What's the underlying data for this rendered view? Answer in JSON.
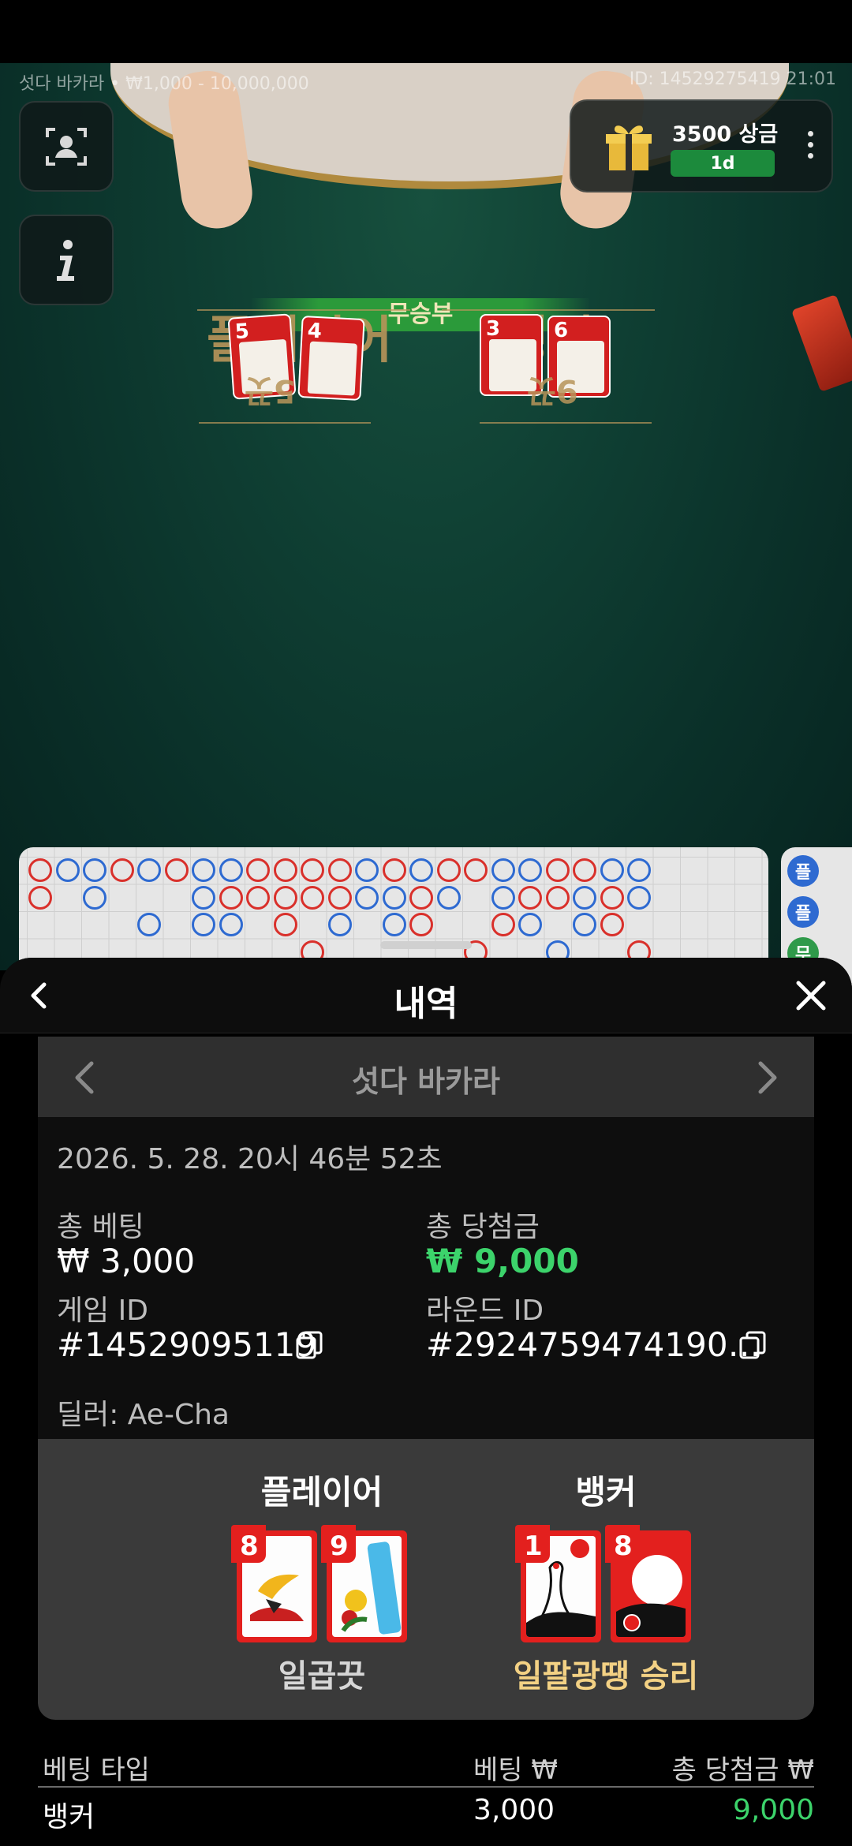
{
  "game": {
    "table_info": "섯다 바카라 • ₩1,000 - 10,000,000",
    "round_info": "ID: 14529275419 21:01",
    "prize": {
      "title": "3500 상금",
      "badge": "1d"
    },
    "tie_label": "무승부",
    "player_label": "플레이어",
    "banker_label": "뱅커",
    "player_cards": [
      "5",
      "4"
    ],
    "banker_cards": [
      "3",
      "6"
    ],
    "player_score": "5끗",
    "banker_score": "9끗",
    "roadmap_side": [
      "플",
      "플",
      "무"
    ]
  },
  "history": {
    "title": "내역",
    "game_name": "섯다 바카라",
    "datetime": "2026. 5. 28. 20시 46분 52초",
    "total_bet_label": "총 베팅",
    "total_bet": "₩ 3,000",
    "total_win_label": "총 당첨금",
    "total_win": "₩ 9,000",
    "game_id_label": "게임 ID",
    "game_id": "#14529095119",
    "round_id_label": "라운드 ID",
    "round_id": "#2924759474190…",
    "dealer": "딜러: Ae-Cha",
    "result": {
      "player_label": "플레이어",
      "banker_label": "뱅커",
      "player_cards": [
        "8",
        "9"
      ],
      "banker_cards": [
        "1",
        "8"
      ],
      "player_outcome": "일곱끗",
      "banker_outcome": "일팔광땡 승리"
    },
    "table": {
      "col_type": "베팅 타입",
      "col_bet": "베팅 ₩",
      "col_win": "총 당첨금 ₩",
      "rows": [
        {
          "type": "뱅커",
          "bet": "3,000",
          "win": "9,000"
        }
      ]
    }
  },
  "colors": {
    "win_green": "#3cd36b",
    "gold": "#f3d184",
    "card_red": "#e3201e",
    "felt": "#0f3f33"
  }
}
